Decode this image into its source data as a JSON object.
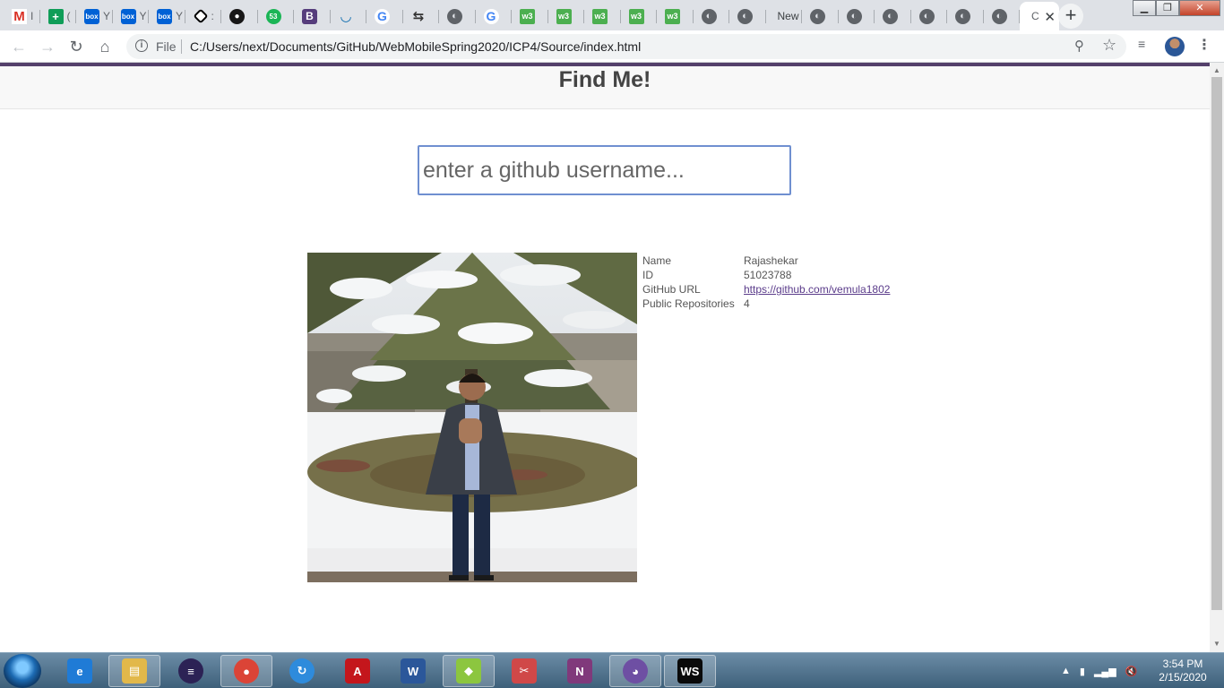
{
  "browser": {
    "tabs": [
      {
        "favicon": "gmail-icon",
        "glyph": "M",
        "style": "gmail",
        "title": "I"
      },
      {
        "favicon": "sheets-icon",
        "glyph": "+",
        "style": "sheets",
        "title": "("
      },
      {
        "favicon": "box-icon",
        "glyph": "box",
        "style": "box",
        "title": "Y"
      },
      {
        "favicon": "box-icon",
        "glyph": "box",
        "style": "box",
        "title": "Y"
      },
      {
        "favicon": "box-icon",
        "glyph": "box",
        "style": "box",
        "title": "Y"
      },
      {
        "favicon": "codepen-icon",
        "glyph": "",
        "style": "codepen",
        "title": ":"
      },
      {
        "favicon": "github-icon",
        "glyph": "●",
        "style": "github",
        "title": ""
      },
      {
        "favicon": "counter-icon",
        "glyph": "53",
        "style": "num",
        "title": ""
      },
      {
        "favicon": "bootstrap-icon",
        "glyph": "B",
        "style": "bootstrap",
        "title": ""
      },
      {
        "favicon": "jquery-icon",
        "glyph": "◡",
        "style": "jquery",
        "title": ""
      },
      {
        "favicon": "google-icon",
        "glyph": "G",
        "style": "google",
        "title": ""
      },
      {
        "favicon": "arrow-icon",
        "glyph": "⇆",
        "style": "arrow",
        "title": ""
      },
      {
        "favicon": "globe-icon",
        "glyph": "◐",
        "style": "globe",
        "title": ""
      },
      {
        "favicon": "google-icon",
        "glyph": "G",
        "style": "google",
        "title": ""
      },
      {
        "favicon": "w3schools-icon",
        "glyph": "w3",
        "style": "w3",
        "title": ""
      },
      {
        "favicon": "w3schools-icon",
        "glyph": "w3",
        "style": "w3",
        "title": ""
      },
      {
        "favicon": "w3schools-icon",
        "glyph": "w3",
        "style": "w3",
        "title": ""
      },
      {
        "favicon": "w3schools-icon",
        "glyph": "w3",
        "style": "w3",
        "title": ""
      },
      {
        "favicon": "w3schools-icon",
        "glyph": "w3",
        "style": "w3",
        "title": ""
      },
      {
        "favicon": "globe-icon",
        "glyph": "◐",
        "style": "globe",
        "title": ""
      },
      {
        "favicon": "globe-icon",
        "glyph": "◐",
        "style": "globe",
        "title": ""
      },
      {
        "favicon": "",
        "glyph": "",
        "style": "none",
        "title": "New"
      },
      {
        "favicon": "globe-icon",
        "glyph": "◐",
        "style": "globe",
        "title": ""
      },
      {
        "favicon": "globe-icon",
        "glyph": "◐",
        "style": "globe",
        "title": ""
      },
      {
        "favicon": "globe-icon",
        "glyph": "◐",
        "style": "globe",
        "title": ""
      },
      {
        "favicon": "globe-icon",
        "glyph": "◐",
        "style": "globe",
        "title": ""
      },
      {
        "favicon": "globe-icon",
        "glyph": "◐",
        "style": "globe",
        "title": ""
      },
      {
        "favicon": "globe-icon",
        "glyph": "◐",
        "style": "globe",
        "title": ""
      },
      {
        "favicon": "",
        "glyph": "",
        "style": "none",
        "title": "C",
        "active": true
      }
    ],
    "new_tab": "+",
    "window_controls": {
      "minimize": "▁",
      "maximize": "❐",
      "close": "✕"
    },
    "nav": {
      "back": "←",
      "forward": "→",
      "reload": "↻",
      "home": "⌂"
    },
    "omnibox": {
      "info": "i",
      "scheme": "File",
      "url": "C:/Users/next/Documents/GitHub/WebMobileSpring2020/ICP4/Source/index.html"
    },
    "icons": {
      "zoom": "⚲",
      "star": "☆",
      "media": "≡",
      "menu": "⋮"
    }
  },
  "page": {
    "title": "Find Me!",
    "search": {
      "placeholder": "enter a github username...",
      "value": ""
    },
    "profile": {
      "rows": [
        {
          "label": "Name",
          "value": "Rajashekar"
        },
        {
          "label": "ID",
          "value": "51023788"
        },
        {
          "label": "GitHub URL",
          "value": "https://github.com/vemula1802",
          "link": true
        },
        {
          "label": "Public Repositories",
          "value": "4"
        }
      ]
    },
    "colors": {
      "accent": "#54406b",
      "link": "#5a3b8a",
      "input_border": "#6f8fd0"
    }
  },
  "taskbar": {
    "apps": [
      {
        "name": "ie-icon",
        "glyph": "e",
        "bg": "#1f7bd6",
        "open": false
      },
      {
        "name": "file-explorer-icon",
        "glyph": "▤",
        "bg": "#e2b84a",
        "open": true
      },
      {
        "name": "eclipse-icon",
        "glyph": "≡",
        "bg": "#2c2255",
        "open": false
      },
      {
        "name": "chrome-icon",
        "glyph": "●",
        "bg": "#db4437",
        "open": true
      },
      {
        "name": "sync-icon",
        "glyph": "↻",
        "bg": "#2e8bdc",
        "open": false
      },
      {
        "name": "acrobat-icon",
        "glyph": "A",
        "bg": "#c4161c",
        "open": false
      },
      {
        "name": "word-icon",
        "glyph": "W",
        "bg": "#2b579a",
        "open": false
      },
      {
        "name": "maps-icon",
        "glyph": "◆",
        "bg": "#8cc63f",
        "open": true
      },
      {
        "name": "snipping-icon",
        "glyph": "✂",
        "bg": "#d04848",
        "open": false
      },
      {
        "name": "onenote-icon",
        "glyph": "N",
        "bg": "#80397b",
        "open": false
      },
      {
        "name": "github-desktop-icon",
        "glyph": "◕",
        "bg": "#6e4fa3",
        "open": true
      },
      {
        "name": "webstorm-icon",
        "glyph": "WS",
        "bg": "#0a0a0a",
        "open": true
      }
    ],
    "tray": {
      "show_hidden": "▲",
      "battery": "▮",
      "signal": "▂▄▆",
      "volume": "🔇"
    },
    "clock": {
      "time": "3:54 PM",
      "date": "2/15/2020"
    }
  }
}
